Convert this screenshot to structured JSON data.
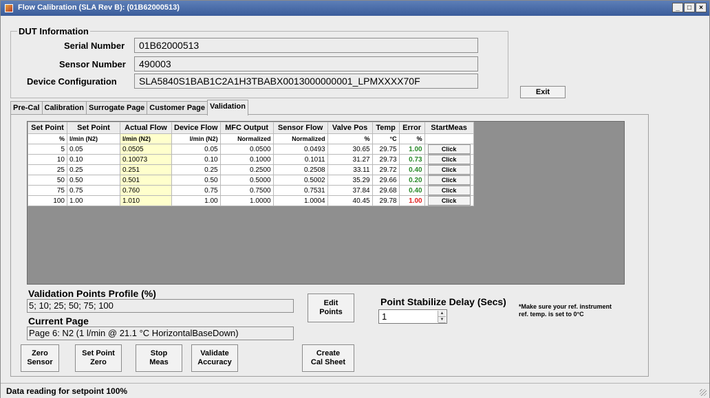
{
  "window": {
    "title": "Flow Calibration (SLA Rev B): (01B62000513)"
  },
  "dut": {
    "group_title": "DUT Information",
    "serial_label": "Serial Number",
    "serial_value": "01B62000513",
    "sensor_label": "Sensor Number",
    "sensor_value": "490003",
    "config_label": "Device Configuration",
    "config_value": "SLA5840S1BAB1C2A1H3TBABX0013000000001_LPMXXXX70F"
  },
  "exit_label": "Exit",
  "tabs": [
    "Pre-Cal",
    "Calibration",
    "Surrogate Page",
    "Customer Page",
    "Validation"
  ],
  "active_tab": "Validation",
  "table": {
    "headers": [
      "Set Point",
      "Set Point",
      "Actual Flow",
      "Device Flow",
      "MFC Output",
      "Sensor Flow",
      "Valve Pos",
      "Temp",
      "Error",
      "StartMeas"
    ],
    "units": [
      "%",
      "l/min (N2)",
      "l/min (N2)",
      "l/min (N2)",
      "Normalized",
      "Normalized",
      "%",
      "°C",
      "%",
      ""
    ],
    "rows": [
      {
        "sp_pct": "5",
        "sp": "0.05",
        "actual": "0.0505",
        "device": "0.05",
        "mfc": "0.0500",
        "sensor": "0.0493",
        "valve": "30.65",
        "temp": "29.75",
        "error": "1.00",
        "error_status": "green",
        "btn": "Click"
      },
      {
        "sp_pct": "10",
        "sp": "0.10",
        "actual": "0.10073",
        "device": "0.10",
        "mfc": "0.1000",
        "sensor": "0.1011",
        "valve": "31.27",
        "temp": "29.73",
        "error": "0.73",
        "error_status": "green",
        "btn": "Click"
      },
      {
        "sp_pct": "25",
        "sp": "0.25",
        "actual": "0.251",
        "device": "0.25",
        "mfc": "0.2500",
        "sensor": "0.2508",
        "valve": "33.11",
        "temp": "29.72",
        "error": "0.40",
        "error_status": "green",
        "btn": "Click"
      },
      {
        "sp_pct": "50",
        "sp": "0.50",
        "actual": "0.501",
        "device": "0.50",
        "mfc": "0.5000",
        "sensor": "0.5002",
        "valve": "35.29",
        "temp": "29.66",
        "error": "0.20",
        "error_status": "green",
        "btn": "Click"
      },
      {
        "sp_pct": "75",
        "sp": "0.75",
        "actual": "0.760",
        "device": "0.75",
        "mfc": "0.7500",
        "sensor": "0.7531",
        "valve": "37.84",
        "temp": "29.68",
        "error": "0.40",
        "error_status": "green",
        "btn": "Click"
      },
      {
        "sp_pct": "100",
        "sp": "1.00",
        "actual": "1.010",
        "device": "1.00",
        "mfc": "1.0000",
        "sensor": "1.0004",
        "valve": "40.45",
        "temp": "29.78",
        "error": "1.00",
        "error_status": "red",
        "btn": "Click"
      }
    ]
  },
  "validation": {
    "profile_label": "Validation Points Profile (%)",
    "profile_value": "5; 10; 25; 50; 75; 100",
    "current_page_label": "Current Page",
    "current_page_value": "Page 6: N2 (1 l/min @ 21.1 °C HorizontalBaseDown)"
  },
  "buttons": {
    "zero_sensor": [
      "Zero",
      "Sensor"
    ],
    "set_point_zero": [
      "Set Point",
      "Zero"
    ],
    "stop_meas": [
      "Stop",
      "Meas"
    ],
    "validate_accuracy": [
      "Validate",
      "Accuracy"
    ],
    "edit_points": [
      "Edit",
      "Points"
    ],
    "create_cal_sheet": [
      "Create",
      "Cal Sheet"
    ]
  },
  "stabilize": {
    "label": "Point Stabilize Delay (Secs)",
    "value": "1"
  },
  "note": [
    "*Make sure your ref. instrument",
    "ref. temp. is set to 0°C"
  ],
  "status": "Data reading for setpoint 100%",
  "colors": {
    "title_bar": "#3a5c9a",
    "actual_flow_bg": "#ffffcc",
    "error_ok": "#2a8a2a",
    "error_bad": "#e02020",
    "grid_bg": "#8f8f8f"
  }
}
